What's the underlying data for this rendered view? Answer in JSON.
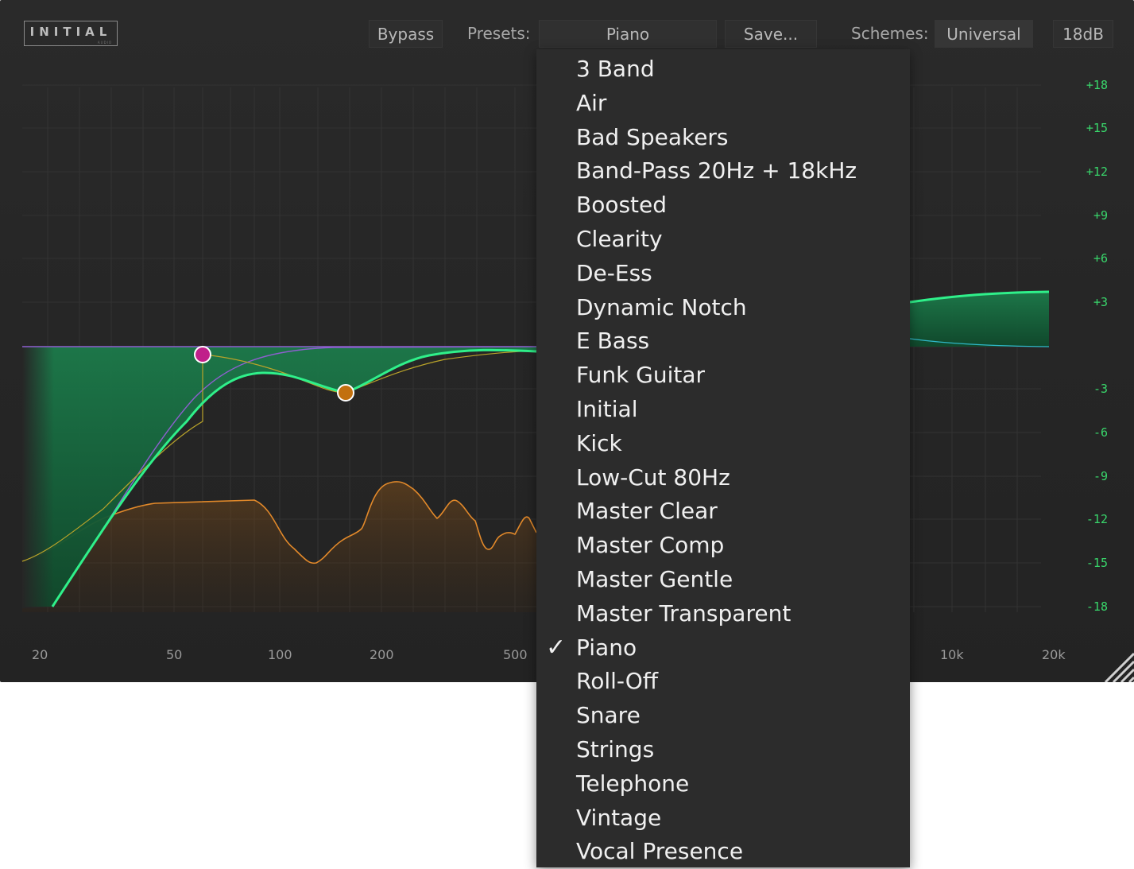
{
  "toolbar": {
    "logo_text": "INITIAL",
    "logo_sub": "AUDIO",
    "bypass_label": "Bypass",
    "presets_label": "Presets:",
    "preset_value": "Piano",
    "save_label": "Save...",
    "schemes_label": "Schemes:",
    "scheme_value": "Universal",
    "range_value": "18dB"
  },
  "graph": {
    "db_scale": [
      "+18",
      "+15",
      "+12",
      "+9",
      "+6",
      "+3",
      "-3",
      "-6",
      "-9",
      "-12",
      "-15",
      "-18"
    ],
    "freq_scale": [
      "20",
      "50",
      "100",
      "200",
      "500",
      "10k",
      "20k"
    ],
    "colors": {
      "eq_curve": "#2ff08a",
      "eq_fill": "#1a6a41",
      "band1_node": "#c01f8a",
      "band2_node": "#c2700f",
      "spectrum": "#e2892a",
      "purple_curve": "#8e5fd0",
      "yellow_curve": "#b9a32a",
      "cyan_curve": "#2fb8c9",
      "db_label": "#39d66b"
    },
    "bands": [
      {
        "name": "band-1",
        "freq_hz": 62,
        "gain_db": -0.5
      },
      {
        "name": "band-2",
        "freq_hz": 175,
        "gain_db": -3.2
      }
    ]
  },
  "preset_menu": {
    "selected": "Piano",
    "items": [
      "3 Band",
      "Air",
      "Bad Speakers",
      "Band-Pass 20Hz + 18kHz",
      "Boosted",
      "Clearity",
      "De-Ess",
      "Dynamic Notch",
      "E Bass",
      "Funk Guitar",
      "Initial",
      "Kick",
      "Low-Cut 80Hz",
      "Master Clear",
      "Master Comp",
      "Master Gentle",
      "Master Transparent",
      "Piano",
      "Roll-Off",
      "Snare",
      "Strings",
      "Telephone",
      "Vintage",
      "Vocal Presence"
    ],
    "check_glyph": "✓"
  }
}
